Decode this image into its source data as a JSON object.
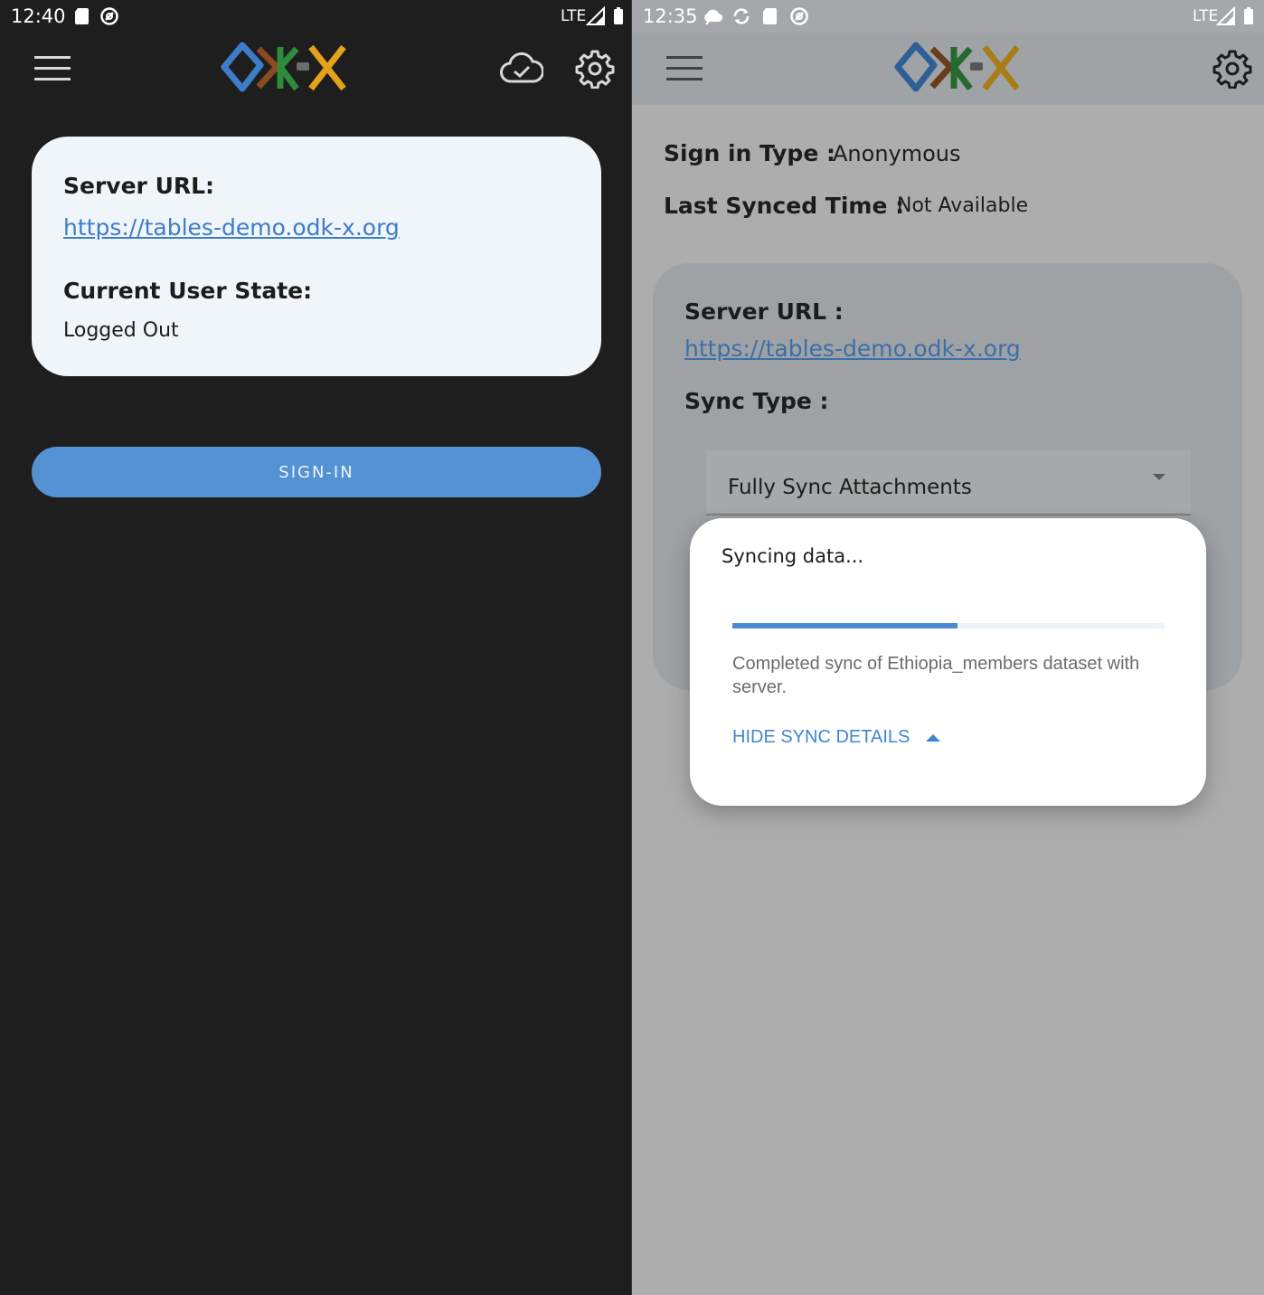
{
  "left_screen": {
    "status_bar": {
      "time": "12:40",
      "network": "LTE",
      "icons": [
        "sd-card-icon",
        "no-disturb-icon",
        "signal-icon",
        "battery-icon"
      ]
    },
    "app_bar": {
      "menu_icon": "menu-icon",
      "logo_text": "ODK-X",
      "icons": [
        "cloud-check-icon",
        "settings-gear-icon"
      ]
    },
    "info_card": {
      "server_url_label": "Server URL:",
      "server_url": "https://tables-demo.odk-x.org",
      "user_state_label": "Current User State:",
      "user_state": "Logged Out"
    },
    "sign_in_button": "SIGN-IN"
  },
  "right_screen": {
    "status_bar": {
      "time": "12:35",
      "network": "LTE",
      "icons": [
        "cloud-sync-icon",
        "sync-icon",
        "sd-card-icon",
        "no-disturb-icon",
        "signal-icon",
        "battery-icon"
      ]
    },
    "app_bar": {
      "menu_icon": "menu-icon",
      "logo_text": "ODK-X",
      "icons": [
        "settings-gear-icon"
      ]
    },
    "sign_in_type_label": "Sign in Type :",
    "sign_in_type_value": "Anonymous",
    "last_synced_label": "Last Synced Time :",
    "last_synced_value": "Not Available",
    "sync_card": {
      "server_url_label": "Server URL :",
      "server_url": "https://tables-demo.odk-x.org",
      "sync_type_label": "Sync Type :",
      "sync_type_selected": "Fully Sync Attachments"
    },
    "sync_dialog": {
      "title": "Syncing data...",
      "progress": 0.52,
      "message": "Completed sync of Ethiopia_members dataset with server.",
      "toggle_label": "HIDE SYNC DETAILS"
    }
  },
  "colors": {
    "accent_blue": "#5592d4",
    "logo_blue": "#3d7cc9",
    "logo_brown": "#8b4a1f",
    "logo_green": "#2e8b3a",
    "logo_orange": "#e3a21a",
    "dark_bg": "#1e1e1f"
  }
}
